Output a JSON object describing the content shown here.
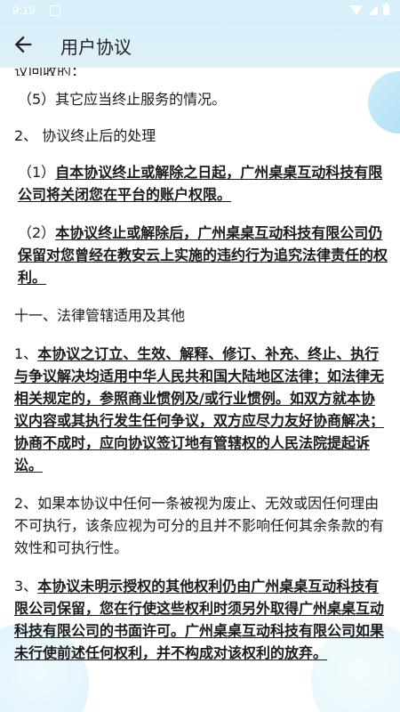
{
  "status_bar": {
    "time": "9:19",
    "icons": [
      "notification-icon",
      "wifi-icon",
      "signal-icon",
      "battery-icon"
    ]
  },
  "app_bar": {
    "title": "用户协议",
    "back_icon": "arrow-left-icon"
  },
  "content": {
    "partial_top": "议回收的；",
    "item5": "（5）其它应当终止服务的情况。",
    "section2_title": "2、 协议终止后的处理",
    "section2_item1_prefix": "（1）",
    "section2_item1_bold": "自本协议终止或解除之日起，广州桌桌互动科技有限公司将关闭您在平台的账户权限。",
    "section2_item2_prefix": "（2）",
    "section2_item2_bold": "本协议终止或解除后，广州桌桌互动科技有限公司仍保留对您曾经在教安云上实施的违约行为追究法律责任的权利。",
    "chapter11_title": "十一、法律管辖适用及其他",
    "clause1_prefix": "1、",
    "clause1_bold": "本协议之订立、生效、解释、修订、补充、终止、执行与争议解决均适用中华人民共和国大陆地区法律；如法律无相关规定的，参照商业惯例及/或行业惯例。如双方就本协议内容或其执行发生任何争议，双方应尽力友好协商解决；协商不成时，应向协议签订地有管辖权的人民法院提起诉讼。",
    "clause2": "2、如果本协议中任何一条被视为废止、无效或因任何理由不可执行，该条应视为可分的且并不影响任何其余条款的有效性和可执行性。",
    "clause3_prefix": "3、",
    "clause3_bold": "本协议未明示授权的其他权利仍由广州桌桌互动科技有限公司保留，您在行使这些权利时须另外取得广州桌桌互动科技有限公司的书面许可。广州桌桌互动科技有限公司如果未行使前述任何权利，并不构成对该权利的放弃。"
  },
  "colors": {
    "app_bar_bg": "#d7eef9",
    "text": "#1b1b1b",
    "accent_deco": "#8fd1f0"
  }
}
